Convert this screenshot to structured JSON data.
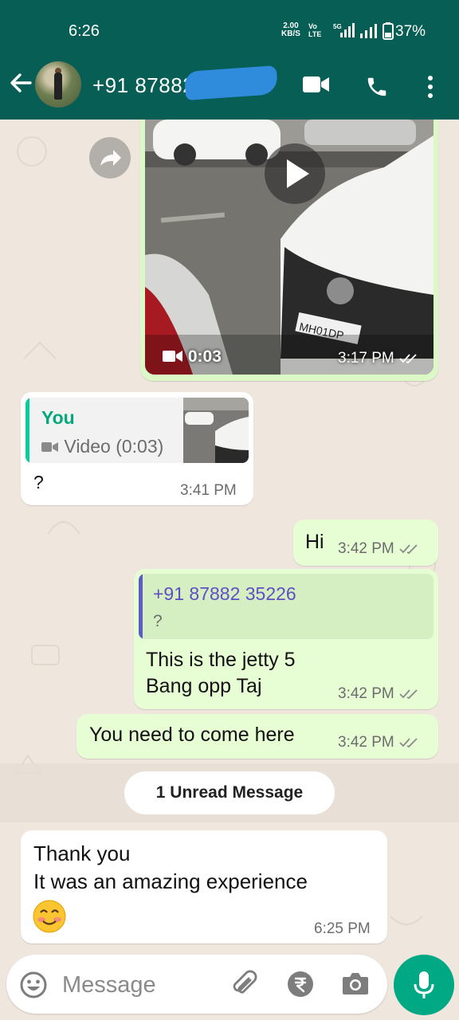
{
  "status_bar": {
    "time": "6:26",
    "net_speed_value": "2.00",
    "net_speed_unit": "KB/S",
    "volte_top": "Vo",
    "volte_bottom": "LTE",
    "net_type": "5G",
    "battery": "37%"
  },
  "header": {
    "contact_name": "+91 87882  26",
    "icons": [
      "back-arrow-icon",
      "video-call-icon",
      "voice-call-icon",
      "more-options-icon"
    ]
  },
  "messages": {
    "video": {
      "duration": "0:03",
      "time": "3:17 PM"
    },
    "reply_video": {
      "quote_author": "You",
      "quote_text": "Video (0:03)",
      "text": "?",
      "time": "3:41 PM"
    },
    "hi": {
      "text": "Hi",
      "time": "3:42 PM"
    },
    "jetty": {
      "quote_author": "+91 87882 35226",
      "quote_text": "?",
      "line1": "This is the jetty 5",
      "line2": "Bang opp Taj",
      "time": "3:42 PM"
    },
    "come_here": {
      "text": "You need to come here",
      "time": "3:42 PM"
    },
    "unread_label": "1 Unread Message",
    "thanks": {
      "line1": "Thank you",
      "line2": "It was an amazing experience",
      "time": "6:25 PM"
    }
  },
  "input": {
    "placeholder": "Message",
    "icons": [
      "emoji-icon",
      "attach-icon",
      "rupee-payment-icon",
      "camera-icon",
      "mic-icon"
    ]
  },
  "colors": {
    "header": "#075e54",
    "outgoing_bubble": "#e7fdd4",
    "incoming_bubble": "#ffffff",
    "accent": "#00a884",
    "chat_bg": "#efe7de"
  }
}
